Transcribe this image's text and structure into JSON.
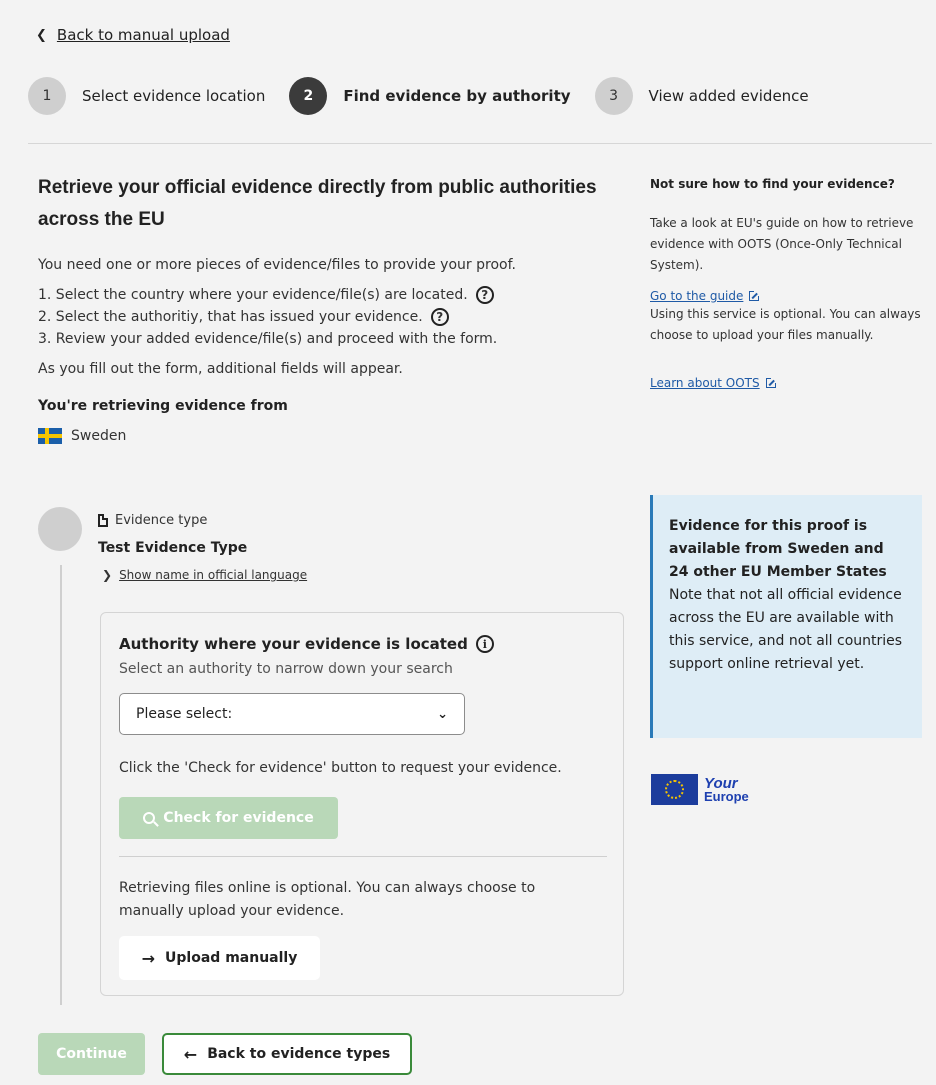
{
  "nav": {
    "back_label": "Back to manual upload"
  },
  "stepper": [
    {
      "num": "1",
      "label": "Select evidence location"
    },
    {
      "num": "2",
      "label": "Find evidence by authority"
    },
    {
      "num": "3",
      "label": "View added evidence"
    }
  ],
  "main": {
    "title": "Retrieve your official evidence directly from public authorities across the EU",
    "intro": "You need one or more pieces of evidence/files to provide your proof.",
    "steps": [
      "1. Select the country where your evidence/file(s) are located.",
      "2. Select the authoritiy, that has issued your evidence.",
      "3. Review your added evidence/file(s) and proceed with the form."
    ],
    "fill_note": "As you fill out the form, additional fields will appear.",
    "retrieving_heading": "You're retrieving evidence from",
    "country": "Sweden"
  },
  "evidence": {
    "type_label": "Evidence type",
    "type_name": "Test Evidence Type",
    "show_name_link": "Show name in official language"
  },
  "authority": {
    "title": "Authority where your evidence is located",
    "subtitle": "Select an authority to narrow down your search",
    "select_value": "Please select:",
    "click_note": "Click the 'Check for evidence' button to request your evidence.",
    "check_button": "Check for evidence",
    "optional_note": "Retrieving files online is optional. You can always choose to manually upload your evidence.",
    "upload_button": "Upload manually"
  },
  "footer": {
    "continue_button": "Continue",
    "back_button": "Back to evidence types"
  },
  "sidebar": {
    "heading": "Not sure how to find your evidence?",
    "guide_text": "Take a look at EU's guide on how to retrieve evidence with OOTS (Once-Only Technical System).",
    "guide_link": "Go to the guide",
    "optional_text": "Using this service is optional. You can always choose to upload your files manually.",
    "learn_link": "Learn about OOTS",
    "info_bold": "Evidence for this proof is available from Sweden and 24 other EU Member States",
    "info_text": "Note that not all official evidence across the EU are available with this service, and not all countries support online retrieval yet.",
    "logo_line1": "Your",
    "logo_line2": "Europe"
  }
}
